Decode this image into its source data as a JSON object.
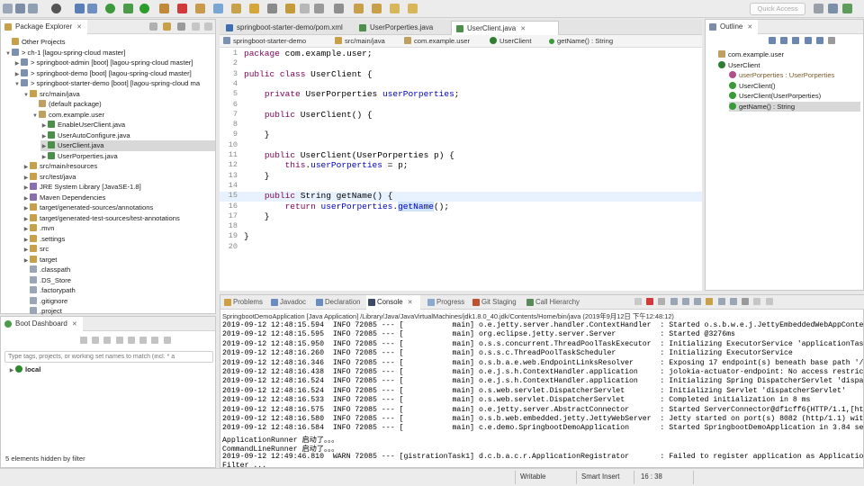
{
  "quick_access": "Quick Access",
  "package_explorer": {
    "tab": "Package Explorer",
    "rows": [
      {
        "text": "Other Projects",
        "indent": 0,
        "twisty": "",
        "icon": "folder",
        "sel": false
      },
      {
        "text": "> ch-1 [lagou-spring-cloud master]",
        "indent": 0,
        "twisty": "▼",
        "icon": "project",
        "sel": false
      },
      {
        "text": "> springboot-admin [boot] [lagou-spring-cloud master]",
        "indent": 1,
        "twisty": "▶",
        "icon": "project",
        "sel": false
      },
      {
        "text": "> springboot-demo [boot] [lagou-spring-cloud master]",
        "indent": 1,
        "twisty": "▶",
        "icon": "project",
        "sel": false
      },
      {
        "text": "> springboot-starter-demo [boot] [lagou-spring-cloud ma",
        "indent": 1,
        "twisty": "▼",
        "icon": "project",
        "sel": false
      },
      {
        "text": "src/main/java",
        "indent": 2,
        "twisty": "▼",
        "icon": "srcfolder",
        "sel": false
      },
      {
        "text": "(default package)",
        "indent": 3,
        "twisty": "",
        "icon": "package",
        "sel": false
      },
      {
        "text": "com.example.user",
        "indent": 3,
        "twisty": "▼",
        "icon": "package",
        "sel": false
      },
      {
        "text": "EnableUserClient.java",
        "indent": 4,
        "twisty": "▶",
        "icon": "java",
        "sel": false
      },
      {
        "text": "UserAutoConfigure.java",
        "indent": 4,
        "twisty": "▶",
        "icon": "java",
        "sel": false
      },
      {
        "text": "UserClient.java",
        "indent": 4,
        "twisty": "▶",
        "icon": "java",
        "sel": true
      },
      {
        "text": "UserPorperties.java",
        "indent": 4,
        "twisty": "▶",
        "icon": "java",
        "sel": false
      },
      {
        "text": "src/main/resources",
        "indent": 2,
        "twisty": "▶",
        "icon": "srcfolder",
        "sel": false
      },
      {
        "text": "src/test/java",
        "indent": 2,
        "twisty": "▶",
        "icon": "srcfolder",
        "sel": false
      },
      {
        "text": "JRE System Library [JavaSE-1.8]",
        "indent": 2,
        "twisty": "▶",
        "icon": "library",
        "sel": false
      },
      {
        "text": "Maven Dependencies",
        "indent": 2,
        "twisty": "▶",
        "icon": "library",
        "sel": false
      },
      {
        "text": "target/generated-sources/annotations",
        "indent": 2,
        "twisty": "▶",
        "icon": "srcfolder",
        "sel": false
      },
      {
        "text": "target/generated-test-sources/test-annotations",
        "indent": 2,
        "twisty": "▶",
        "icon": "srcfolder",
        "sel": false
      },
      {
        "text": ".mvn",
        "indent": 2,
        "twisty": "▶",
        "icon": "folder",
        "sel": false
      },
      {
        "text": ".settings",
        "indent": 2,
        "twisty": "▶",
        "icon": "folder",
        "sel": false
      },
      {
        "text": "src",
        "indent": 2,
        "twisty": "▶",
        "icon": "folder",
        "sel": false
      },
      {
        "text": "target",
        "indent": 2,
        "twisty": "▶",
        "icon": "folder",
        "sel": false
      },
      {
        "text": ".classpath",
        "indent": 2,
        "twisty": "",
        "icon": "file",
        "sel": false
      },
      {
        "text": ".DS_Store",
        "indent": 2,
        "twisty": "",
        "icon": "file",
        "sel": false
      },
      {
        "text": ".factorypath",
        "indent": 2,
        "twisty": "",
        "icon": "file",
        "sel": false
      },
      {
        "text": ".gitignore",
        "indent": 2,
        "twisty": "",
        "icon": "file",
        "sel": false
      },
      {
        "text": ".project",
        "indent": 2,
        "twisty": "",
        "icon": "file",
        "sel": false
      }
    ]
  },
  "boot_dashboard": {
    "tab": "Boot Dashboard",
    "filter_placeholder": "Type tags, projects, or working set names to match (incl. * a",
    "item": "local",
    "footer": "5 elements hidden by filter"
  },
  "editor": {
    "tabs": [
      "springboot-starter-demo/pom.xml",
      "UserPorperties.java",
      "UserClient.java"
    ],
    "breadcrumb": [
      "springboot-starter-demo",
      "src/main/java",
      "com.example.user",
      "UserClient",
      "getName() : String"
    ],
    "lines": [
      "package com.example.user;",
      "",
      "public class UserClient {",
      "",
      "    private UserPorperties userPorperties;",
      "",
      "    public UserClient() {",
      "",
      "    }",
      "",
      "    public UserClient(UserPorperties p) {",
      "        this.userPorperties = p;",
      "    }",
      "",
      "    public String getName() {",
      "        return userPorperties.getName();",
      "    }",
      "",
      "}",
      ""
    ]
  },
  "outline": {
    "tab": "Outline",
    "items": [
      {
        "text": "com.example.user",
        "indent": 0,
        "icon": "package"
      },
      {
        "text": "UserClient",
        "indent": 0,
        "icon": "class"
      },
      {
        "text": "userPorperties : UserPorperties",
        "indent": 1,
        "icon": "field"
      },
      {
        "text": "UserClient()",
        "indent": 1,
        "icon": "method"
      },
      {
        "text": "UserClient(UserPorperties)",
        "indent": 1,
        "icon": "method"
      },
      {
        "text": "getName() : String",
        "indent": 1,
        "icon": "method"
      }
    ]
  },
  "console": {
    "tabs": [
      "Problems",
      "Javadoc",
      "Declaration",
      "Console",
      "Progress",
      "Git Staging",
      "Call Hierarchy"
    ],
    "header": "SpringbootDemoApplication [Java Application] /Library/Java/JavaVirtualMachines/jdk1.8.0_40.jdk/Contents/Home/bin/java (2019年9月12日 下午12:48:12)",
    "lines": [
      "2019-09-12 12:48:15.594  INFO 72085 --- [           main] o.e.jetty.server.handler.ContextHandler  : Started o.s.b.w.e.j.JettyEmbeddedWebAppContext@",
      "2019-09-12 12:48:15.595  INFO 72085 --- [           main] org.eclipse.jetty.server.Server          : Started @3276ms",
      "2019-09-12 12:48:15.950  INFO 72085 --- [           main] o.s.s.concurrent.ThreadPoolTaskExecutor  : Initializing ExecutorService 'applicationTaskEx",
      "2019-09-12 12:48:16.260  INFO 72085 --- [           main] o.s.s.c.ThreadPoolTaskScheduler          : Initializing ExecutorService",
      "2019-09-12 12:48:16.346  INFO 72085 --- [           main] o.s.b.a.e.web.EndpointLinksResolver      : Exposing 17 endpoint(s) beneath base path '/act",
      "2019-09-12 12:48:16.438  INFO 72085 --- [           main] o.e.j.s.h.ContextHandler.application     : jolokia-actuator-endpoint: No access restrictor",
      "2019-09-12 12:48:16.524  INFO 72085 --- [           main] o.e.j.s.h.ContextHandler.application     : Initializing Spring DispatcherServlet 'dispatch",
      "2019-09-12 12:48:16.524  INFO 72085 --- [           main] o.s.web.servlet.DispatcherServlet        : Initializing Servlet 'dispatcherServlet'",
      "2019-09-12 12:48:16.533  INFO 72085 --- [           main] o.s.web.servlet.DispatcherServlet        : Completed initialization in 8 ms",
      "2019-09-12 12:48:16.575  INFO 72085 --- [           main] o.e.jetty.server.AbstractConnector       : Started ServerConnector@df1cff6{HTTP/1.1,[http/",
      "2019-09-12 12:48:16.580  INFO 72085 --- [           main] o.s.b.web.embedded.jetty.JettyWebServer  : Jetty started on port(s) 8082 (http/1.1) with c",
      "2019-09-12 12:48:16.584  INFO 72085 --- [           main] c.e.demo.SpringbootDemoApplication       : Started SpringbootDemoApplication in 3.84 secon",
      "ApplicationRunner 启动了。。。",
      "CommandLineRunner 启动了。。。",
      "2019-09-12 12:49:46.810  WARN 72085 --- [gistrationTask1] d.c.b.a.c.r.ApplicationRegistrator       : Failed to register application as Application(n",
      "Filter ..."
    ]
  },
  "status": {
    "writable": "Writable",
    "insert": "Smart Insert",
    "position": "16 : 38"
  },
  "colors": {
    "keyword": "#7f0055",
    "field": "#0000c0",
    "selection": "#cfe3fb",
    "current_line": "#e8f2fe"
  }
}
